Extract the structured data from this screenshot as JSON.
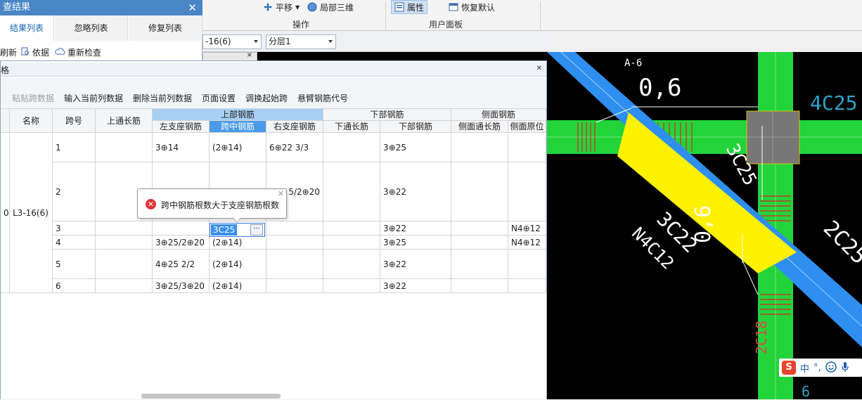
{
  "ribbon": {
    "items": [
      {
        "label": "平移"
      },
      {
        "label": "局部三维"
      },
      {
        "label": "属性"
      },
      {
        "label": "恢复默认"
      }
    ],
    "groups": {
      "ops": "操作",
      "user_panel": "用户面板"
    }
  },
  "selectors": {
    "member": "-16(6)",
    "layer": "分层1"
  },
  "check_panel": {
    "title": "查结果",
    "tabs": [
      "结果列表",
      "忽略列表",
      "修复列表"
    ],
    "tools": [
      "刷新",
      "依据",
      "重新检查"
    ]
  },
  "window": {
    "title": "格",
    "toolbar": [
      "粘贴跨数据",
      "输入当前列数据",
      "删除当前列数据",
      "页面设置",
      "调换起始跨",
      "悬臂钢筋代号"
    ]
  },
  "table": {
    "group_headers": [
      "上部钢筋",
      "下部钢筋",
      "侧面钢筋"
    ],
    "headers": {
      "name": "名称",
      "span": "跨号",
      "top_through": "上通长筋",
      "left_support": "左支座钢筋",
      "mid_span": "跨中钢筋",
      "right_support": "右支座钢筋",
      "bottom_through": "下通长筋",
      "bottom_bar": "下部钢筋",
      "side_through": "侧面通长筋",
      "side_original": "侧面原位"
    },
    "left_fragment": "0",
    "member_name": "L3-16(6)",
    "rows": [
      {
        "span": "1",
        "left": "3⊕14",
        "mid": "(2⊕14)",
        "right": "6⊕22 3/3",
        "bottom": "3⊕25",
        "side": ""
      },
      {
        "span": "2",
        "left": "",
        "mid": "",
        "right": "5/2⊕20",
        "bottom": "3⊕22",
        "side": ""
      },
      {
        "span": "3",
        "left": "",
        "mid": "",
        "right": "",
        "bottom": "3⊕22",
        "side": "N4⊕12"
      },
      {
        "span": "4",
        "left": "3⊕25/2⊕20",
        "mid": "(2⊕14)",
        "right": "",
        "bottom": "3⊕25",
        "side": "N4⊕12"
      },
      {
        "span": "5",
        "left": "4⊕25 2/2",
        "mid": "(2⊕14)",
        "right": "",
        "bottom": "3⊕22",
        "side": ""
      },
      {
        "span": "6",
        "left": "3⊕25/3⊕20",
        "mid": "(2⊕14)",
        "right": "",
        "bottom": "3⊕22",
        "side": ""
      }
    ],
    "editing_value": "3C25"
  },
  "tooltip": {
    "text": "跨中钢筋根数大于支座钢筋根数"
  },
  "cad": {
    "labels": [
      "A-6",
      "0,6",
      "4C25",
      "3C25",
      "3C22",
      "N4C12",
      "0,6",
      "2C25",
      "2C18",
      "6"
    ]
  },
  "ime": {
    "items": [
      "中",
      "°,"
    ]
  }
}
